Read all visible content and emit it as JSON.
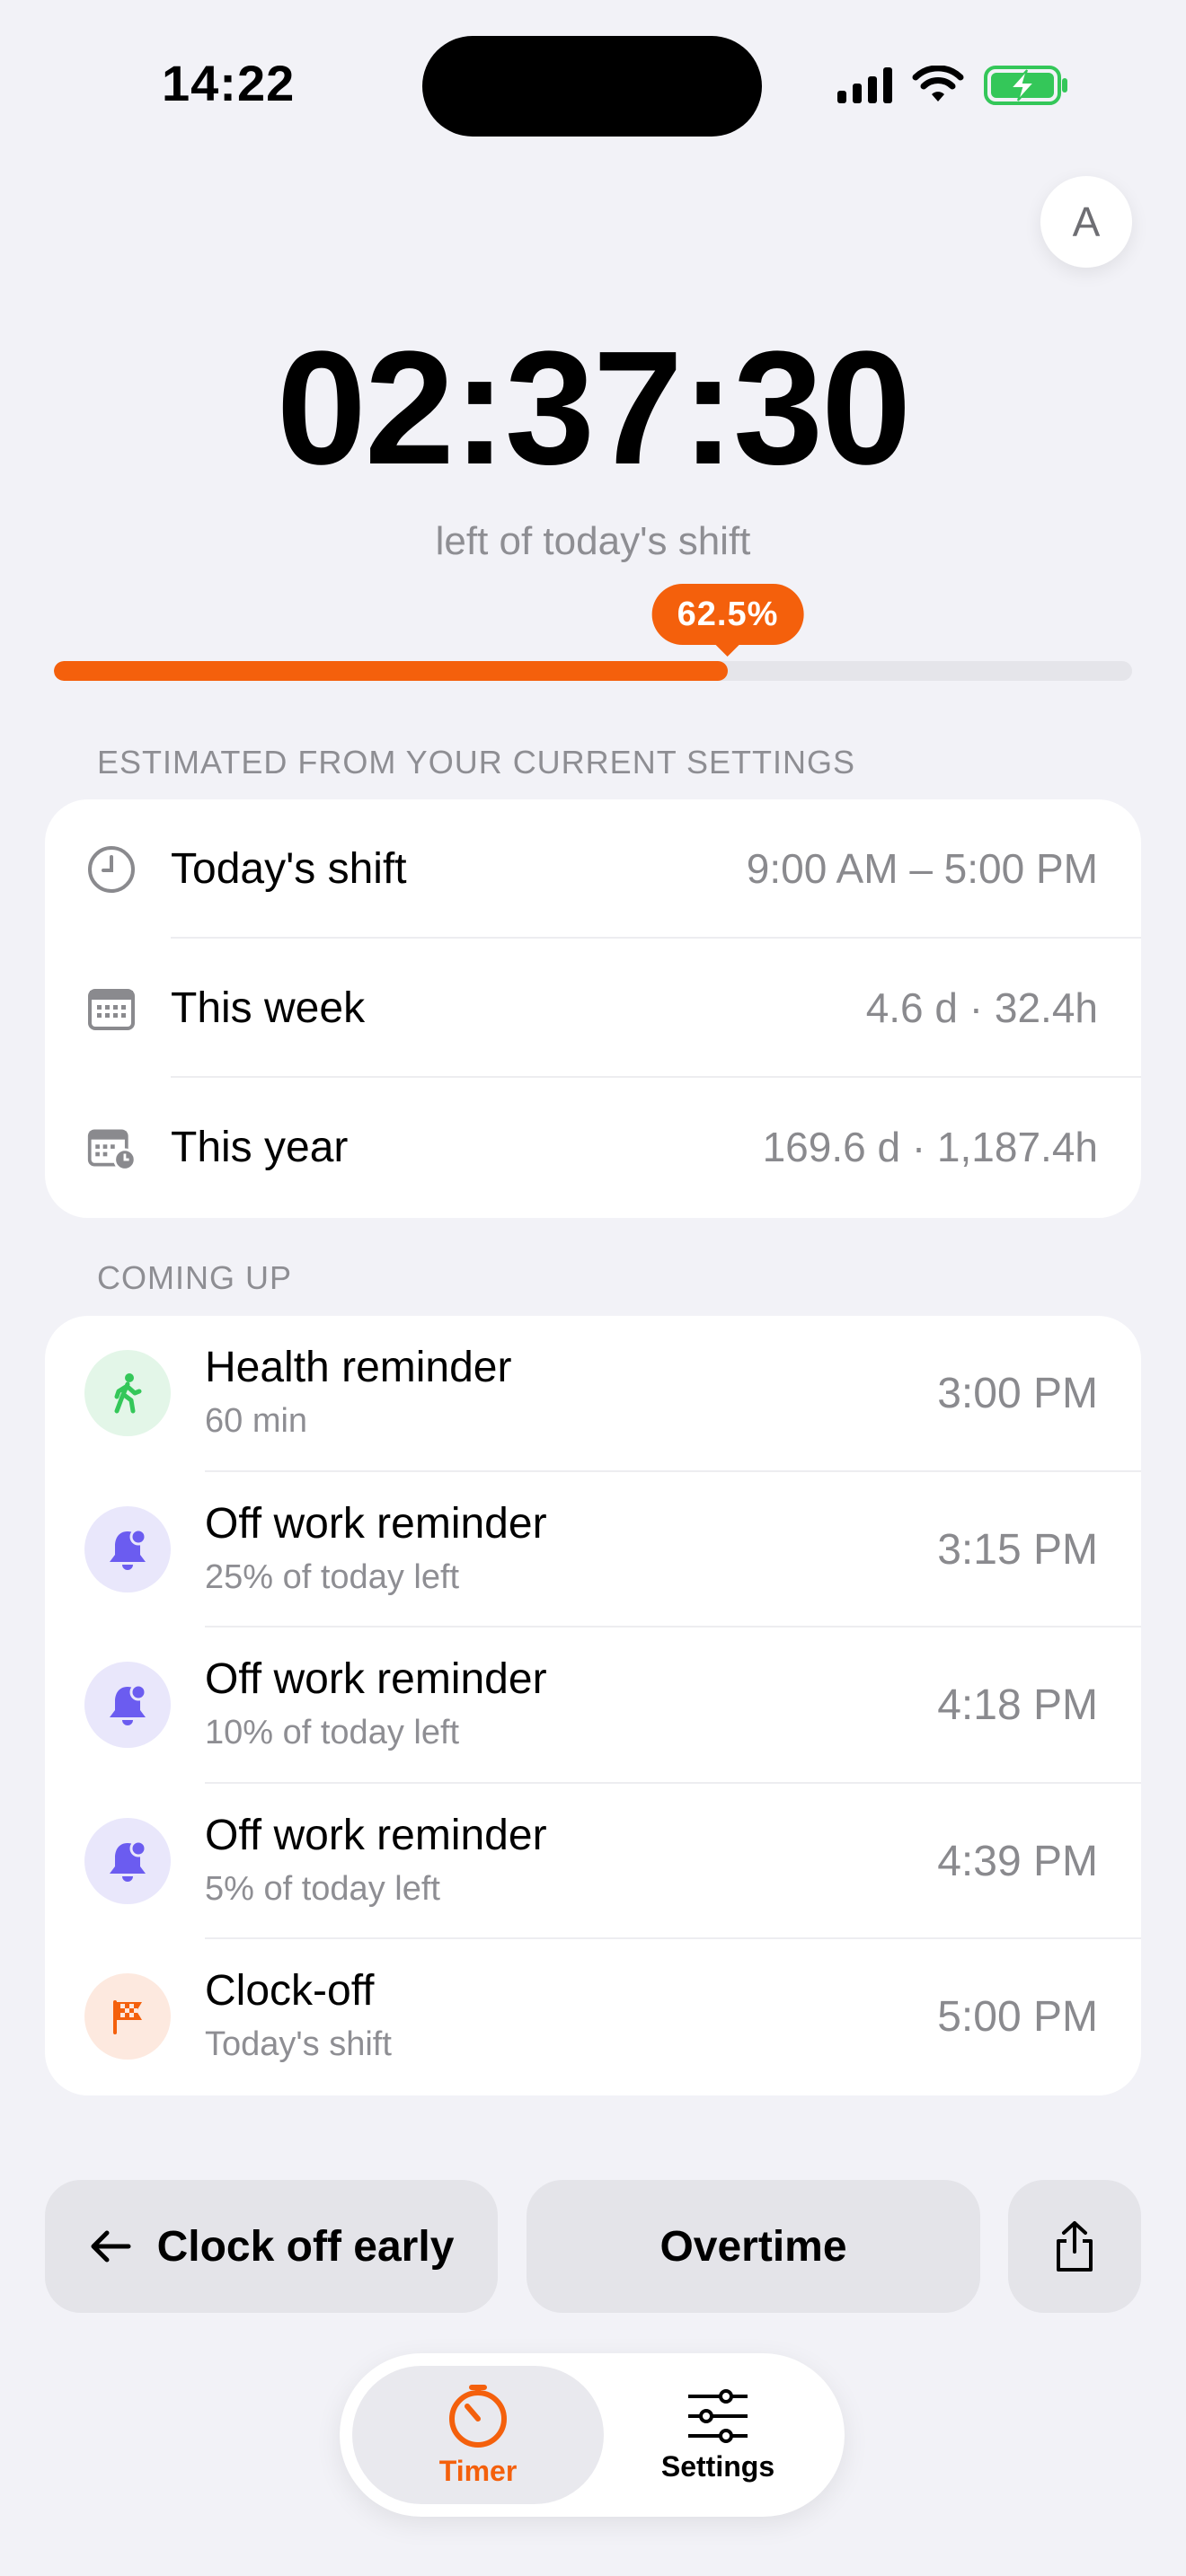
{
  "status_bar": {
    "time": "14:22"
  },
  "avatar": {
    "initial": "A"
  },
  "timer": {
    "remaining": "02:37:30",
    "subtitle": "left of today's shift"
  },
  "progress": {
    "percent_label": "62.5%",
    "fraction": 0.625,
    "accent_color": "#f4600c"
  },
  "estimates": {
    "header": "ESTIMATED FROM YOUR CURRENT SETTINGS",
    "rows": [
      {
        "icon": "clock-icon",
        "label": "Today's shift",
        "value": "9:00 AM – 5:00 PM"
      },
      {
        "icon": "calendar-icon",
        "label": "This week",
        "value": "4.6 d · 32.4h"
      },
      {
        "icon": "calendar-clock-icon",
        "label": "This year",
        "value": "169.6 d · 1,187.4h"
      }
    ]
  },
  "coming_up": {
    "header": "COMING UP",
    "items": [
      {
        "icon": "walking-person-icon",
        "icon_color": "#34c759",
        "icon_bg": "#e3f6e8",
        "title": "Health reminder",
        "subtitle": "60 min",
        "time": "3:00 PM"
      },
      {
        "icon": "bell-icon",
        "icon_color": "#6b5cf0",
        "icon_bg": "#e9e7fb",
        "title": "Off work reminder",
        "subtitle": "25% of today left",
        "time": "3:15 PM"
      },
      {
        "icon": "bell-icon",
        "icon_color": "#6b5cf0",
        "icon_bg": "#e9e7fb",
        "title": "Off work reminder",
        "subtitle": "10% of today left",
        "time": "4:18 PM"
      },
      {
        "icon": "bell-icon",
        "icon_color": "#6b5cf0",
        "icon_bg": "#e9e7fb",
        "title": "Off work reminder",
        "subtitle": "5% of today left",
        "time": "4:39 PM"
      },
      {
        "icon": "checkered-flag-icon",
        "icon_color": "#f4600c",
        "icon_bg": "#fde9df",
        "title": "Clock-off",
        "subtitle": "Today's shift",
        "time": "5:00 PM"
      }
    ]
  },
  "actions": {
    "clock_off_early": "Clock off early",
    "overtime": "Overtime",
    "share_icon": "share-icon"
  },
  "tabbar": {
    "tabs": [
      {
        "label": "Timer",
        "icon": "timer-icon",
        "active": true
      },
      {
        "label": "Settings",
        "icon": "sliders-icon",
        "active": false
      }
    ]
  }
}
